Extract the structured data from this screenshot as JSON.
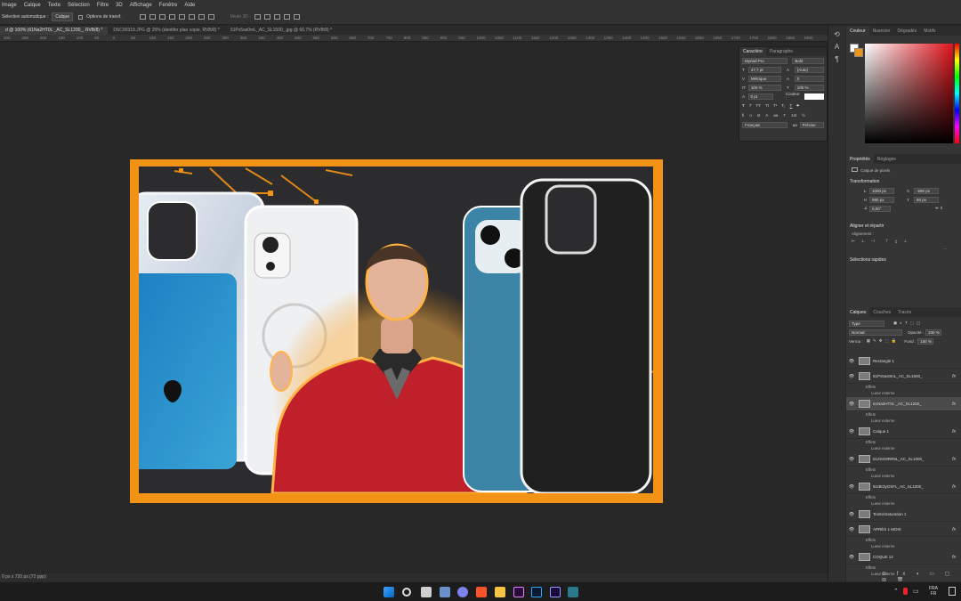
{
  "menu": [
    "Image",
    "Calque",
    "Texte",
    "Sélection",
    "Filtre",
    "3D",
    "Affichage",
    "Fenêtre",
    "Aide"
  ],
  "options": {
    "auto_select_label": "Sélection automatique :",
    "auto_select_value": "Calque",
    "transform_label": "Options de transf.",
    "mode3d_label": "Mode 3D :"
  },
  "tabs": [
    {
      "label": "d @ 100% (61Na2HT0L _AC_SL1200_, RVB/8) *",
      "active": true
    },
    {
      "label": "DSC00319.JPG @ 25% (dentifer plan copie, RVB/8) *",
      "active": false
    },
    {
      "label": "51Pv5as0mL_AC_SL1500_.jpg @ 66,7% (RVB/8) *",
      "active": false
    }
  ],
  "ruler_ticks": [
    "300",
    "250",
    "200",
    "150",
    "100",
    "50",
    "0",
    "50",
    "100",
    "150",
    "200",
    "250",
    "300",
    "350",
    "400",
    "450",
    "500",
    "550",
    "600",
    "650",
    "700",
    "750",
    "800",
    "850",
    "900",
    "950",
    "1000",
    "1050",
    "1100",
    "1150",
    "1200",
    "1250",
    "1300",
    "1350",
    "1400",
    "1450",
    "1500",
    "1550",
    "1600",
    "1650",
    "1700",
    "1750",
    "1800",
    "1850",
    "1900"
  ],
  "status": "0 px x 720 px (72 ppp)",
  "character": {
    "tabs": [
      "Caractère",
      "Paragraphe"
    ],
    "font": "Myriad Pro",
    "style": "Bold",
    "size": "47,7 pt",
    "leading": "(Auto)",
    "kerning": "Métrique",
    "tracking": "0",
    "vscale": "100 %",
    "hscale": "100 %",
    "baseline": "0 pt",
    "color_label": "Couleur :",
    "language": "Français",
    "aa": "Précise"
  },
  "color_panel": {
    "tabs": [
      "Couleur",
      "Nuancier",
      "Dégradés",
      "Motifs"
    ]
  },
  "properties": {
    "tabs": [
      "Propriétés",
      "Réglages"
    ],
    "kind": "Calque de pixels",
    "transform_title": "Transformation",
    "w": "1000 px",
    "x": "-590 px",
    "h": "980 px",
    "y": "60 px",
    "angle": "0,00°",
    "align_title": "Aligner et répartir",
    "align_label": "Alignement :",
    "quick_title": "Sélections rapides"
  },
  "layers_panel": {
    "tabs": [
      "Calques",
      "Couches",
      "Tracés"
    ],
    "filter": "Type",
    "blend": "Normal",
    "opacity_label": "Opacité :",
    "opacity": "100 %",
    "lock_label": "Verrou :",
    "fill_label": "Fond :",
    "fill": "100 %",
    "layers": [
      {
        "name": "Rectangle 1",
        "fx": false,
        "effects": []
      },
      {
        "name": "51Pv5as0mL_AC_SL1500_",
        "fx": true,
        "effects": [
          "Effets",
          "Lueur externe"
        ]
      },
      {
        "name": "61Na2HT0L _AC_SL1200_",
        "fx": true,
        "effects": [
          "Effets",
          "Lueur externe"
        ],
        "selected": true
      },
      {
        "name": "Calque 1",
        "fx": true,
        "effects": [
          "Effets",
          "Lueur externe"
        ]
      },
      {
        "name": "61ZSG9RR9L_AC_SL1000_",
        "fx": true,
        "effects": [
          "Effets",
          "Lueur externe"
        ]
      },
      {
        "name": "51rBr3yGSFL_AC_SL1000_",
        "fx": true,
        "effects": [
          "Effets",
          "Lueur externe"
        ]
      },
      {
        "name": "Teinte/Saturation 1",
        "fx": false,
        "effects": []
      },
      {
        "name": "APRÈS 1 MOIS",
        "fx": true,
        "effects": [
          "Effets",
          "Lueur externe"
        ]
      },
      {
        "name": "COQUE 12",
        "fx": true,
        "effects": [
          "Effets",
          "Lueur externe"
        ]
      }
    ]
  },
  "taskbar": {
    "lang1": "FRA",
    "lang2": "FR"
  },
  "colors": {
    "accent_orange": "#f39316",
    "shirt_red": "#c0202a",
    "phone_blue": "#2b8fc6"
  }
}
